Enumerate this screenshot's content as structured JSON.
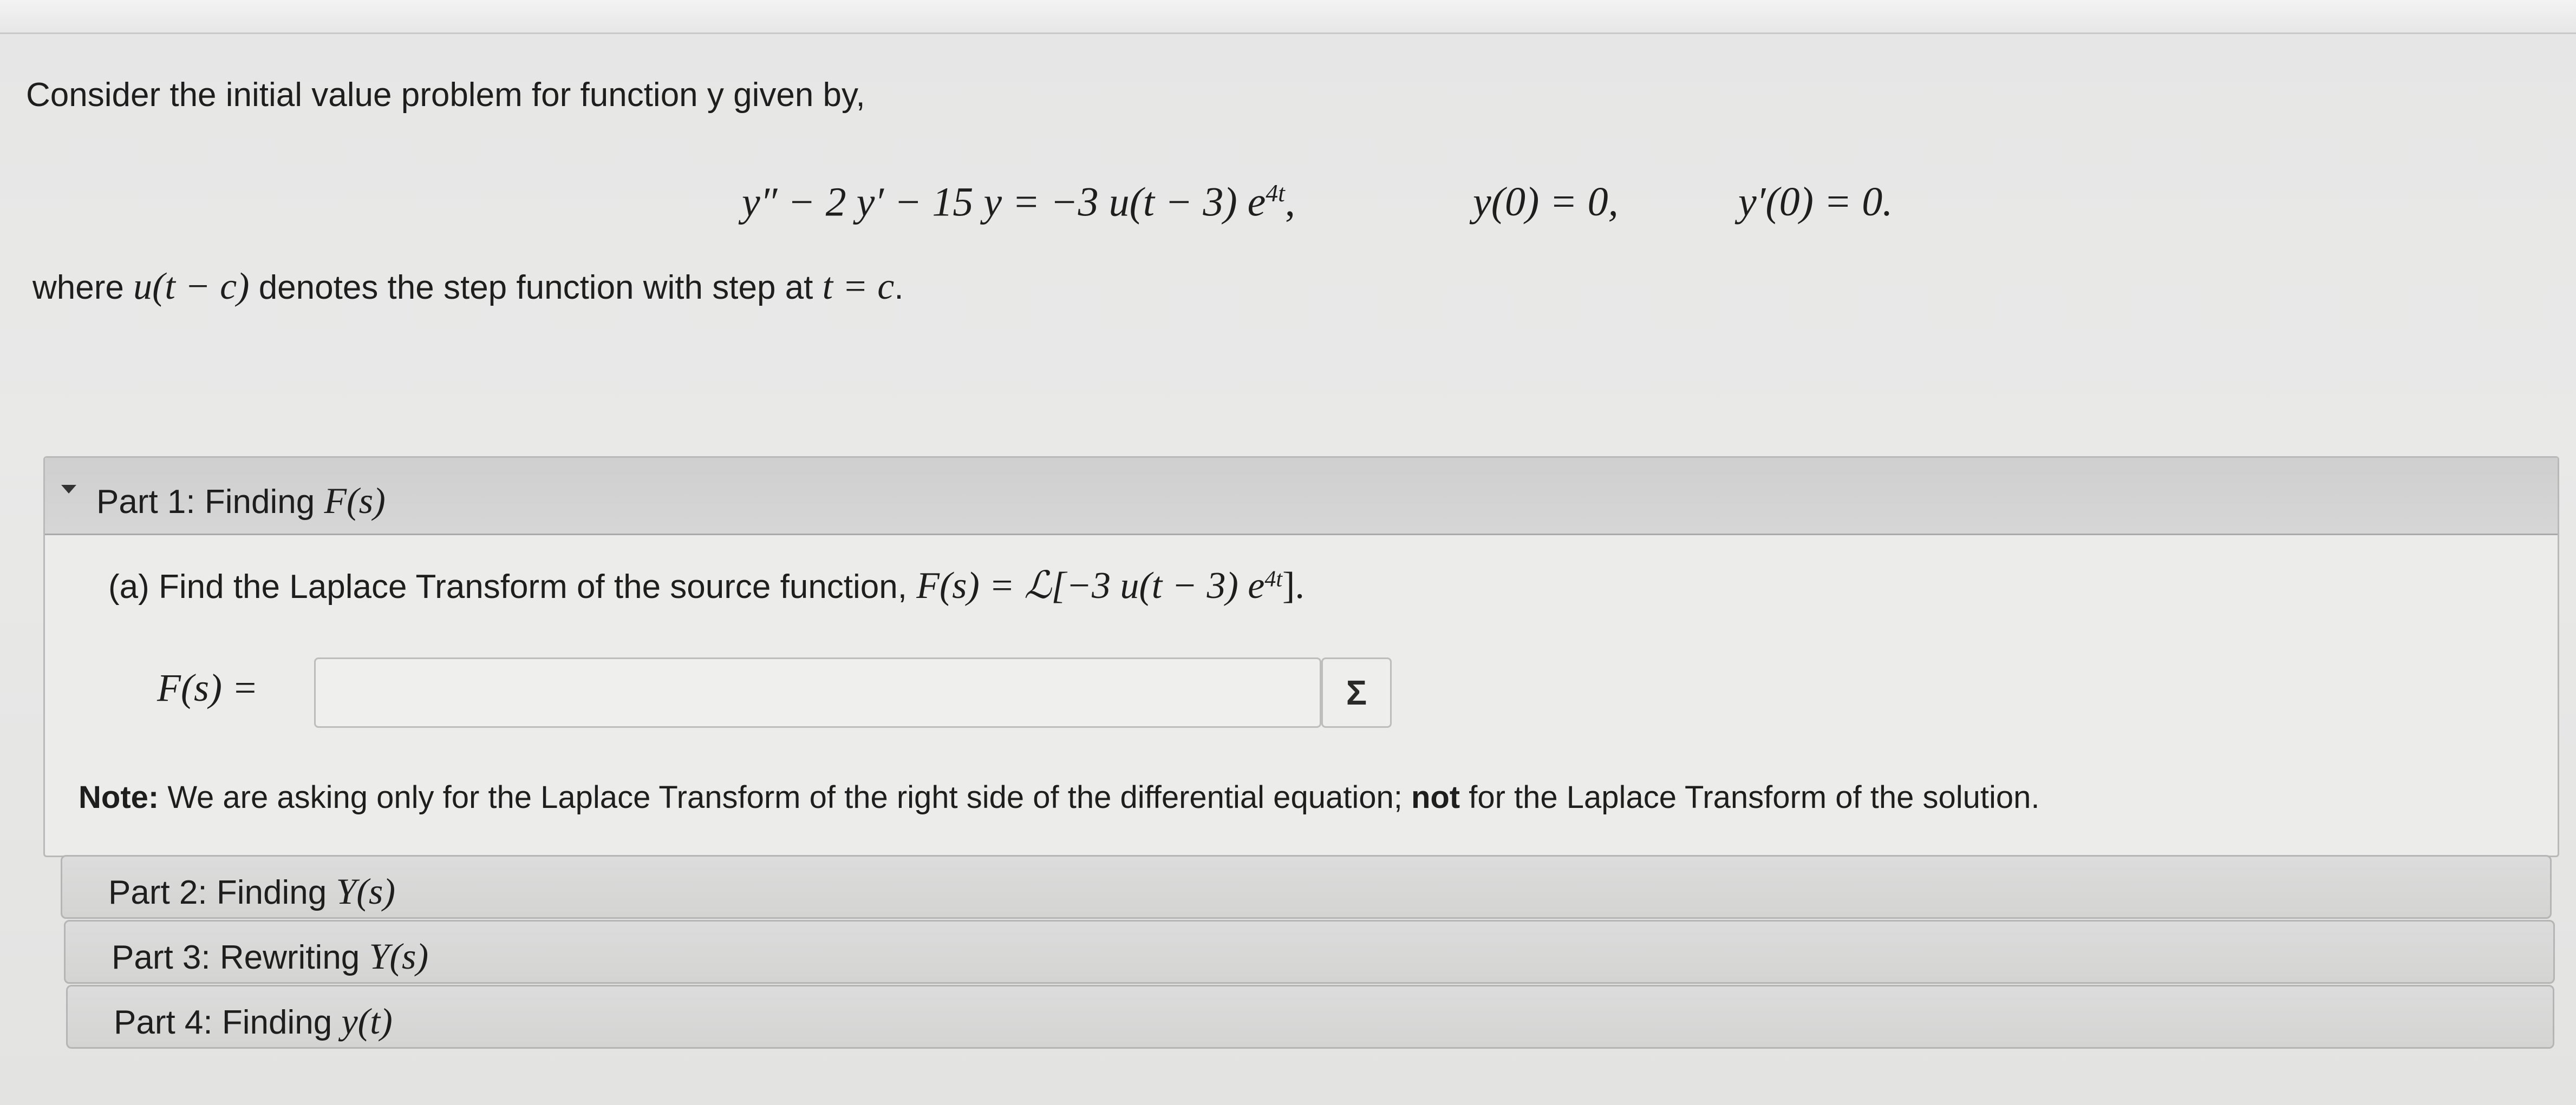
{
  "problem": {
    "intro": "Consider the initial value problem for function y given by,",
    "equation_lhs": "y″ − 2 y′ − 15 y = −3 u(t − 3) e",
    "equation_exp": "4t",
    "equation_tail": ",",
    "initial_condition_1": "y(0) = 0,",
    "initial_condition_2": "y′(0) = 0.",
    "where_prefix": "where ",
    "where_func": "u(t − c)",
    "where_mid": " denotes the step function with step at ",
    "where_eq": "t = c",
    "where_end": "."
  },
  "part1": {
    "title_prefix": "Part 1: Finding ",
    "title_math": "F(s)",
    "question_text": "(a) Find the Laplace Transform of the source function, ",
    "question_math": "F(s) = ℒ[−3 u(t − 3) e",
    "question_exp": "4t",
    "question_end": "].",
    "answer_label": "F(s) =",
    "answer_value": "",
    "sigma_label": "Σ",
    "note_bold": "Note:",
    "note_text_1": " We are asking only for the Laplace Transform of the right side of the differential equation; ",
    "note_not": "not",
    "note_text_2": " for the Laplace Transform of the solution."
  },
  "part2": {
    "title_prefix": "Part 2: Finding ",
    "title_math": "Y(s)"
  },
  "part3": {
    "title_prefix": "Part 3: Rewriting ",
    "title_math": "Y(s)"
  },
  "part4": {
    "title_prefix": "Part 4: Finding ",
    "title_math": "y(t)"
  },
  "icons": {
    "expand": "caret-down-icon",
    "math_editor": "sigma-icon"
  },
  "colors": {
    "background": "#e8e8e7",
    "header": "#d2d2d2",
    "border": "#b9b9b9",
    "text": "#1e1e1e"
  }
}
